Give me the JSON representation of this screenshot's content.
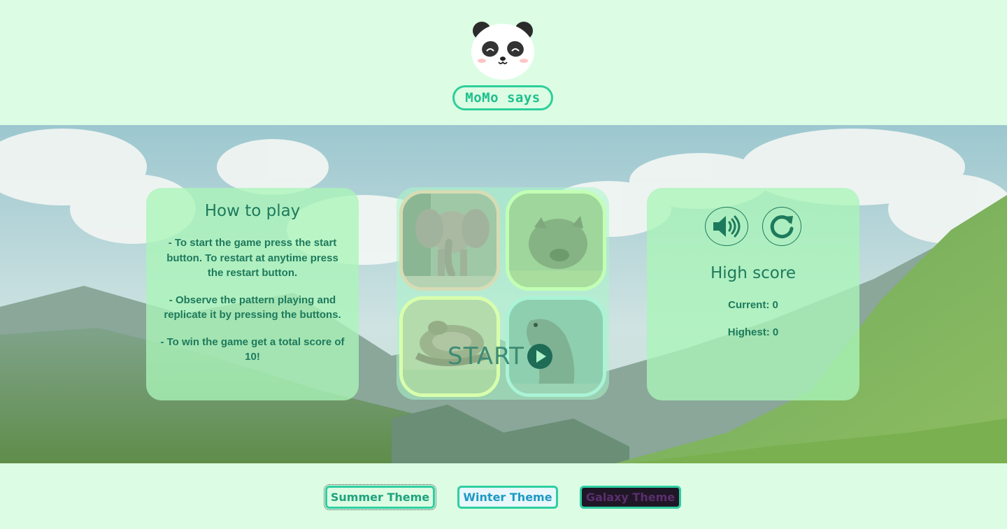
{
  "header": {
    "logo_icon": "panda-icon",
    "title": "MoMo says"
  },
  "how_to_play": {
    "title": "How to play",
    "instructions": [
      "- To start the game press the start button. To restart at anytime press the restart button.",
      "- Observe the pattern playing and replicate it by pressing the buttons.",
      "- To win the game get a total score of 10!"
    ]
  },
  "board": {
    "tiles": [
      {
        "animal": "elephant"
      },
      {
        "animal": "pig"
      },
      {
        "animal": "snake"
      },
      {
        "animal": "seal"
      }
    ],
    "start_label": "START",
    "start_icon": "play-icon"
  },
  "score": {
    "sound_icon": "volume-icon",
    "restart_icon": "restart-icon",
    "title": "High score",
    "current": "Current: 0",
    "highest": "Highest: 0"
  },
  "themes": {
    "summer": "Summer Theme",
    "winter": "Winter Theme",
    "galaxy": "Galaxy Theme"
  },
  "colors": {
    "page_background": "#dcfde3",
    "accent": "#2ecf9c",
    "text": "#1e7a5c"
  }
}
